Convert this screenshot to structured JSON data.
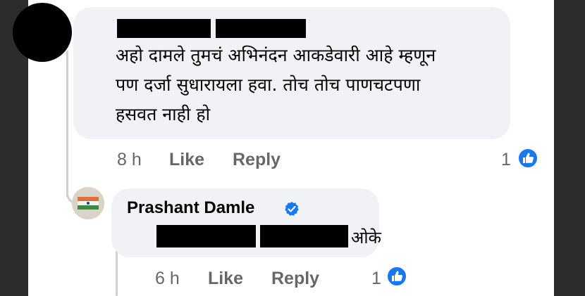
{
  "comment": {
    "text_lines": [
      "अहो दामले तुमचं अभिनंदन आकडेवारी आहे म्हणून",
      "पण दर्जा सुधारायला हवा. तोच तोच पाणचटपणा",
      "हसवत नाही हो"
    ],
    "time": "8 h",
    "like_label": "Like",
    "reply_label": "Reply",
    "reaction_count": "1"
  },
  "reply": {
    "author": "Prashant Damle",
    "text_tail": "ओके",
    "time": "6 h",
    "like_label": "Like",
    "reply_label": "Reply",
    "reaction_count": "1"
  },
  "colors": {
    "bubble": "#f0f2f5",
    "meta": "#65676b",
    "facebook_blue": "#1877f2",
    "thread_line": "#ced0d4"
  },
  "icons": {
    "verified": "verified-badge-icon",
    "like_reaction": "like-reaction-icon"
  }
}
